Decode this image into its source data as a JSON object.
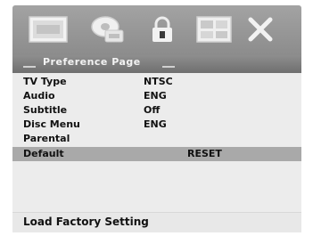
{
  "header": {
    "icons": [
      {
        "name": "general-setup-icon"
      },
      {
        "name": "audio-setup-icon"
      },
      {
        "name": "password-lock-icon"
      },
      {
        "name": "preference-icon"
      },
      {
        "name": "exit-icon"
      }
    ],
    "page_title": "Preference Page"
  },
  "menu": {
    "items": [
      {
        "label": "TV Type",
        "value": "NTSC"
      },
      {
        "label": "Audio",
        "value": "ENG"
      },
      {
        "label": "Subtitle",
        "value": "Off"
      },
      {
        "label": "Disc Menu",
        "value": "ENG"
      },
      {
        "label": "Parental",
        "value": ""
      },
      {
        "label": "Default",
        "value": "RESET"
      }
    ]
  },
  "footer": {
    "hint": "Load Factory Setting"
  },
  "colors": {
    "iconbar": "#9a9a9a",
    "highlight": "#a9a9a9",
    "panel": "#ececec"
  }
}
